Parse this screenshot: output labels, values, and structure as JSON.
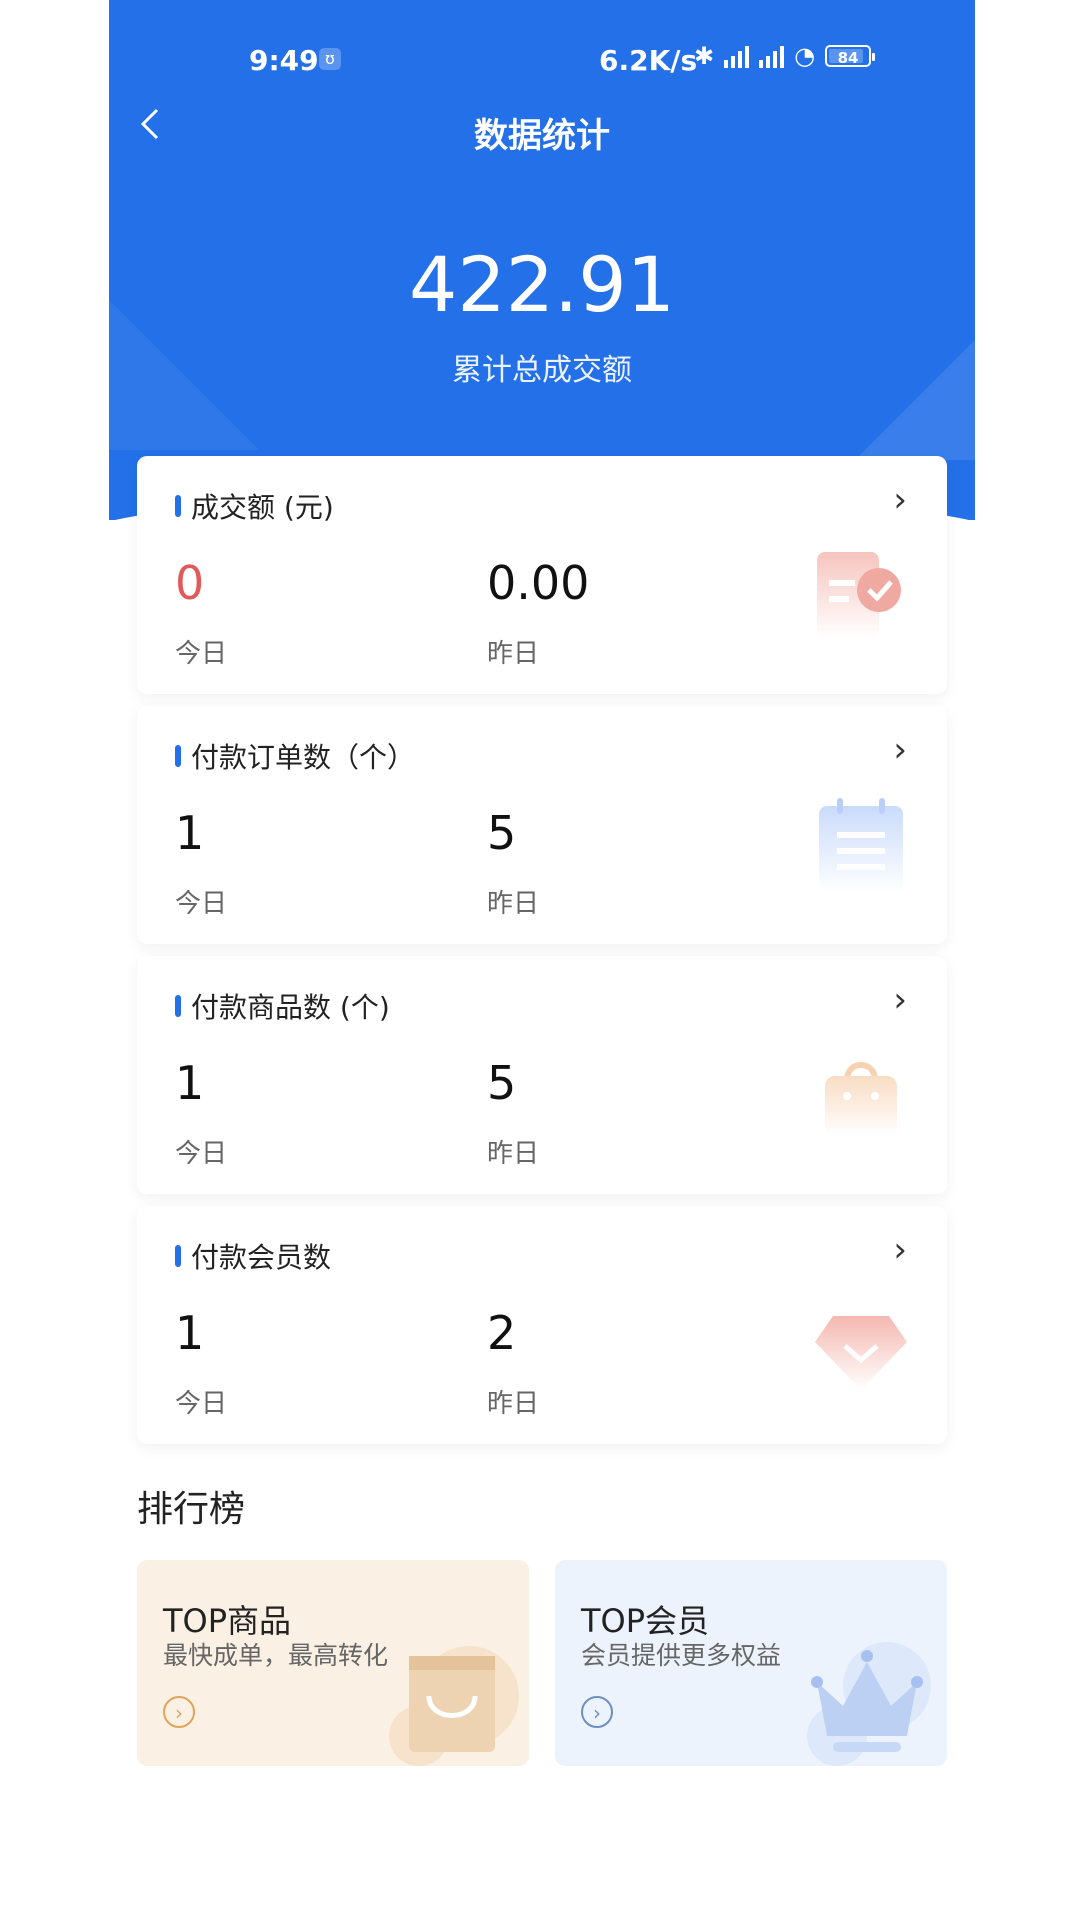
{
  "status_bar": {
    "time": "9:49",
    "network_speed": "6.2K/s",
    "battery": "84"
  },
  "header": {
    "title": "数据统计",
    "total_value": "422.91",
    "total_label": "累计总成交额"
  },
  "cards": [
    {
      "title": "成交额 (元)",
      "today": "0",
      "yesterday": "0.00",
      "today_label": "今日",
      "yesterday_label": "昨日",
      "icon": "receipt-check-icon"
    },
    {
      "title": "付款订单数（个）",
      "today": "1",
      "yesterday": "5",
      "today_label": "今日",
      "yesterday_label": "昨日",
      "icon": "clipboard-icon"
    },
    {
      "title": "付款商品数 (个)",
      "today": "1",
      "yesterday": "5",
      "today_label": "今日",
      "yesterday_label": "昨日",
      "icon": "shopping-bag-icon"
    },
    {
      "title": "付款会员数",
      "today": "1",
      "yesterday": "2",
      "today_label": "今日",
      "yesterday_label": "昨日",
      "icon": "diamond-icon"
    }
  ],
  "ranking": {
    "title": "排行榜",
    "items": [
      {
        "title": "TOP商品",
        "subtitle": "最快成单，最高转化",
        "icon": "gift-bag-icon"
      },
      {
        "title": "TOP会员",
        "subtitle": "会员提供更多权益",
        "icon": "crown-icon"
      }
    ]
  },
  "colors": {
    "primary": "#2370e8",
    "today_zero": "#e05a5a",
    "rank_goods_bg": "#fbf0e4",
    "rank_member_bg": "#edf3fc"
  }
}
